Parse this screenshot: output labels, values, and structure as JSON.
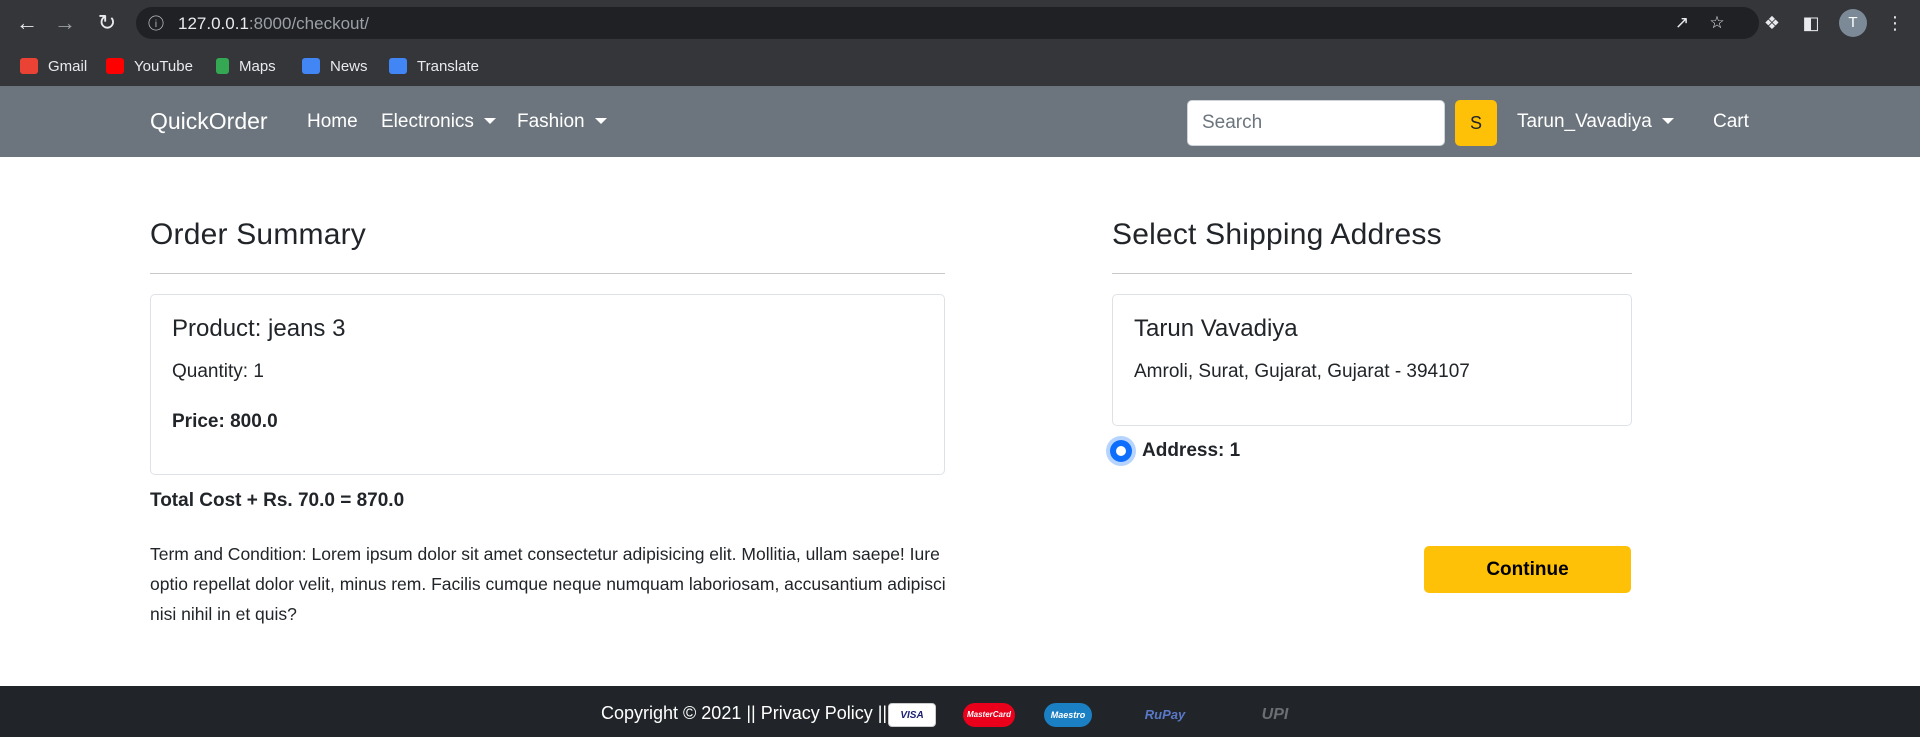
{
  "browser": {
    "url_host": "127.0.0.1",
    "url_rest": ":8000/checkout/",
    "profile_initial": "T",
    "bookmarks": [
      {
        "label": "Gmail",
        "icon": "gmail-icon",
        "color": "#ea4335"
      },
      {
        "label": "YouTube",
        "icon": "youtube-icon",
        "color": "#ff0000"
      },
      {
        "label": "Maps",
        "icon": "maps-icon",
        "color": "#34a853"
      },
      {
        "label": "News",
        "icon": "news-icon",
        "color": "#4285f4"
      },
      {
        "label": "Translate",
        "icon": "translate-icon",
        "color": "#4285f4"
      }
    ]
  },
  "navbar": {
    "brand": "QuickOrder",
    "links": [
      {
        "label": "Home"
      },
      {
        "label": "Electronics",
        "dropdown": true
      },
      {
        "label": "Fashion",
        "dropdown": true
      }
    ],
    "search_placeholder": "Search",
    "search_button": "S",
    "user": "Tarun_Vavadiya",
    "cart": "Cart"
  },
  "order_summary": {
    "heading": "Order Summary",
    "product_title": "Product: jeans 3",
    "quantity": "Quantity: 1",
    "price": "Price: 800.0",
    "total": "Total Cost + Rs. 70.0 = 870.0",
    "terms": "Term and Condition: Lorem ipsum dolor sit amet consectetur adipisicing elit. Mollitia, ullam saepe! Iure optio repellat dolor velit, minus rem. Facilis cumque neque numquam laboriosam, accusantium adipisci nisi nihil in et quis?"
  },
  "shipping": {
    "heading": "Select Shipping Address",
    "name": "Tarun Vavadiya",
    "address": "Amroli, Surat, Gujarat, Gujarat - 394107",
    "radio_label": "Address: 1",
    "radio_checked": true,
    "continue_label": "Continue"
  },
  "footer": {
    "text": "Copyright © 2021 || Privacy Policy ||",
    "payment_methods": [
      "VISA",
      "MasterCard",
      "Maestro",
      "RuPay",
      "UPI"
    ]
  },
  "colors": {
    "navbar_bg": "#6c757d",
    "accent": "#ffc107",
    "footer_bg": "#212529",
    "radio": "#0d6efd"
  }
}
